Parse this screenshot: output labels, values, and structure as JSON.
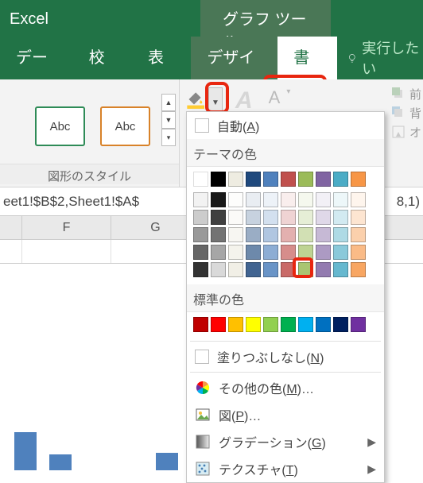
{
  "title": {
    "app_name": "Excel",
    "context_tab": "グラフ ツール"
  },
  "tabs": {
    "data": "データ",
    "review": "校閲",
    "view": "表示",
    "design": "デザイン",
    "format": "書式",
    "tell_me": "実行したい"
  },
  "ribbon": {
    "shape_label": "Abc",
    "group_name": "図形のスタイル",
    "opt_prev": "前",
    "opt_back": "背",
    "opt_obj": "オ"
  },
  "formula": {
    "left": "eet1!$B$2,Sheet1!$A$",
    "right": "8,1)"
  },
  "cols": {
    "f": "F",
    "g": "G"
  },
  "fill_menu": {
    "auto": "自動(",
    "auto_u": "A",
    "auto_end": ")",
    "theme_header": "テーマの色",
    "standard_header": "標準の色",
    "nofill": "塗りつぶしなし(",
    "nofill_u": "N",
    "nofill_end": ")",
    "more": "その他の色(",
    "more_u": "M",
    "more_end": ")…",
    "picture": "図(",
    "picture_u": "P",
    "picture_end": ")…",
    "gradient": "グラデーション(",
    "gradient_u": "G",
    "gradient_end": ")",
    "texture": "テクスチャ(",
    "texture_u": "T",
    "texture_end": ")"
  },
  "theme_colors_row1": [
    "#ffffff",
    "#000000",
    "#eeece1",
    "#1f497d",
    "#4f81bd",
    "#c0504d",
    "#9bbb59",
    "#8064a2",
    "#4bacc6",
    "#f79646"
  ],
  "theme_shades": {
    "shade_steps": [
      0.9,
      0.75,
      0.55,
      0.35,
      0.15
    ],
    "cols": [
      "#ffffff",
      "#000000",
      "#eeece1",
      "#1f497d",
      "#4f81bd",
      "#c0504d",
      "#9bbb59",
      "#8064a2",
      "#4bacc6",
      "#f79646"
    ]
  },
  "standard_colors": [
    "#c00000",
    "#ff0000",
    "#ffc000",
    "#ffff00",
    "#92d050",
    "#00b050",
    "#00b0f0",
    "#0070c0",
    "#002060",
    "#7030a0"
  ]
}
